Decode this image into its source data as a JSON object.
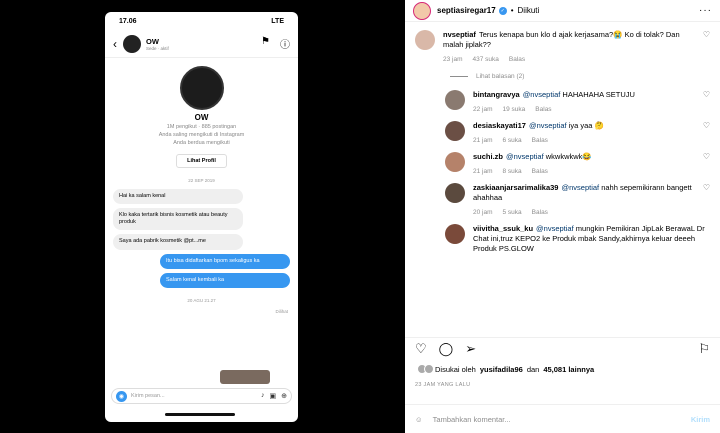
{
  "phone": {
    "time": "17.06",
    "net": "LTE",
    "chat_name": "OW",
    "chat_sub": "Sede · aktif",
    "profile_name": "OW",
    "followers": "1M pengikut · 885 postingan",
    "mutual": "Anda saling mengikuti di Instagram",
    "follows_note": "Anda berdua mengikuti",
    "view_profile": "Lihat Profil",
    "date1": "22 SEP 2019",
    "messages": [
      {
        "dir": "in",
        "text": "Hai ka salam kenal"
      },
      {
        "dir": "in",
        "text": "Klo kaka tertarik bisnis kosmetik atau beauty produk"
      },
      {
        "dir": "in",
        "text": "Saya ada pabrik kosmetik @pt...me"
      },
      {
        "dir": "out",
        "text": "Itu bisa didaftarkan bpom sekaligus ka"
      },
      {
        "dir": "out",
        "text": "Salam kenal kembali ka"
      }
    ],
    "date2": "20 AGU 21.27",
    "seen": "Dilihat",
    "composer_placeholder": "Kirim pesan..."
  },
  "post": {
    "username": "septiasiregar17",
    "follow_state": "Diikuti",
    "comments": [
      {
        "user": "nvseptiaf",
        "mention": "",
        "text": "Terus kenapa bun klo d ajak kerjasama?😭 Ko di tolak? Dan malah jiplak??",
        "time": "23 jam",
        "likes": "437 suka",
        "reply": "Balas",
        "is_reply": false,
        "avatar_color": "#d9b8a8"
      },
      {
        "user": "bintangravya",
        "mention": "@nvseptiaf",
        "text": "HAHAHAHA SETUJU",
        "time": "22 jam",
        "likes": "19 suka",
        "reply": "Balas",
        "is_reply": true,
        "avatar_color": "#8a7a70"
      },
      {
        "user": "desiaskayati17",
        "mention": "@nvseptiaf",
        "text": "iya yaa 🤔",
        "time": "21 jam",
        "likes": "6 suka",
        "reply": "Balas",
        "is_reply": true,
        "avatar_color": "#6b4f45"
      },
      {
        "user": "suchi.zb",
        "mention": "@nvseptiaf",
        "text": "wkwkwkwk😂",
        "time": "21 jam",
        "likes": "8 suka",
        "reply": "Balas",
        "is_reply": true,
        "avatar_color": "#b5826a"
      },
      {
        "user": "zaskiaanjarsarimalika39",
        "mention": "@nvseptiaf",
        "text": "nahh sepemikirann bangett ahahhaa",
        "time": "20 jam",
        "likes": "5 suka",
        "reply": "Balas",
        "is_reply": true,
        "avatar_color": "#5b4a3e"
      },
      {
        "user": "viivitha_ssuk_ku",
        "mention": "@nvseptiaf",
        "text": "mungkin Pemikiran JipLak BerawaL Dr Chat ini,truz KEPO2 ke Produk mbak Sandy,akhirnya keluar deeeh Produk PS.GLOW",
        "time": "",
        "likes": "",
        "reply": "",
        "is_reply": true,
        "avatar_color": "#7a4a3a"
      }
    ],
    "view_replies": "Lihat balasan (2)",
    "liked_by": "Disukai oleh",
    "liked_user": "yusifadila96",
    "liked_and": "dan",
    "liked_count": "45,081 lainnya",
    "posted": "23 JAM YANG LALU",
    "add_comment_placeholder": "Tambahkan komentar...",
    "post_button": "Kirim"
  },
  "colors": {
    "accent": "#3797f0",
    "verified": "#3897f0"
  },
  "icons": {
    "heart": "heart-icon",
    "comment": "comment-icon",
    "share": "share-icon",
    "bookmark": "bookmark-icon",
    "emoji": "emoji-icon"
  }
}
